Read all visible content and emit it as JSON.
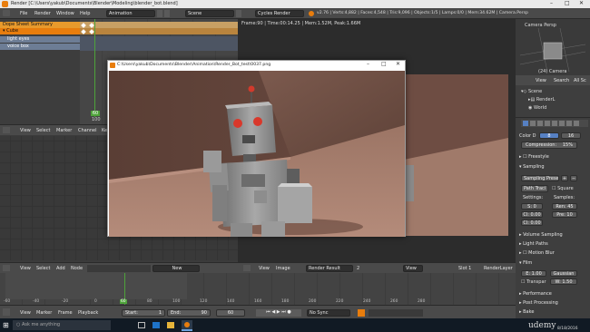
{
  "window": {
    "title": "Render [C:\\Users\\yakub\\Documents\\Blender\\Modeling\\blender_bot.blend]"
  },
  "menu": {
    "items": [
      "File",
      "Render",
      "Window",
      "Help"
    ],
    "layout": "Animation",
    "scene": "Scene",
    "engine": "Cycles Render",
    "stats": "v2.76 | Verts:4,882 | Faces:4,548 | Tris:9,096 | Objects:1/5 | Lamps:0/0 | Mem:34.62M | Camera.Persp"
  },
  "dopesheet": {
    "channels": [
      "Dope Sheet Summary",
      "Cube",
      "light eyes",
      "voice box"
    ],
    "frame_marker": "60",
    "ruler": [
      "60",
      "100"
    ],
    "header_items": [
      "View",
      "Select",
      "Marker",
      "Channel",
      "Key"
    ]
  },
  "image_editor": {
    "info": "Frame:90 | Time:00:14.25 | Mem:1.52M, Peak:1.66M",
    "header_items": [
      "View",
      "Image"
    ],
    "render_result": "Render Result",
    "slot_num": "2",
    "view_label": "View",
    "slot": "Slot 1",
    "layer": "RenderLayer"
  },
  "popup": {
    "title": "C:\\Users\\yakub\\Documents\\Blender\\Animation\\Render_Bot_test\\0037.png"
  },
  "outliner": {
    "view_label": "Camera Persp",
    "camera_label": "(24) Camera",
    "header_items": [
      "View",
      "Search",
      "All Sc"
    ],
    "tree": [
      "Scene",
      "RenderL",
      "World"
    ]
  },
  "properties": {
    "color_d_label": "Color D",
    "color_d_value": "8",
    "color_d_value2": "16",
    "compression_label": "Compression:",
    "compression_value": "15%",
    "freestyle": "Freestyle",
    "sampling": "Sampling",
    "sampling_presets": "Sampling Presets",
    "path_tracing": "Path Traci",
    "square": "Square",
    "settings": "Settings:",
    "samples": "Samples:",
    "seed_label": "S",
    "seed_value": "0",
    "clamp1_label": "Cl",
    "clamp1_value": "0.00",
    "clamp2_label": "Cl",
    "clamp2_value": "0.00",
    "render_samples_label": "Ren",
    "render_samples_value": "45",
    "preview_samples_label": "Pre",
    "preview_samples_value": "10",
    "volume_sampling": "Volume Sampling",
    "light_paths": "Light Paths",
    "motion_blur": "Motion Blur",
    "film": "Film",
    "film_exposure_label": "E",
    "film_exposure_value": "1.00",
    "film_filter": "Gaussian",
    "transparent": "Transpar",
    "filter_width_label": "W",
    "filter_width_value": "1.50",
    "performance": "Performance",
    "post_processing": "Post Processing",
    "bake": "Bake"
  },
  "action_editor": {
    "header_items": [
      "View",
      "Select",
      "Add",
      "Node"
    ],
    "action": "New"
  },
  "timeline": {
    "ticks": [
      "-60",
      "-40",
      "-20",
      "0",
      "20",
      "40",
      "60",
      "80",
      "100",
      "120",
      "140",
      "160",
      "180",
      "200",
      "220",
      "240",
      "260",
      "280"
    ],
    "current_frame": "60",
    "header_items": [
      "View",
      "Marker",
      "Frame",
      "Playback"
    ],
    "start_label": "Start:",
    "start_value": "1",
    "end_label": "End:",
    "end_value": "90",
    "frame_value": "60",
    "sync": "No Sync"
  },
  "taskbar": {
    "search_placeholder": "Ask me anything",
    "time": "8/18/2016",
    "watermark": "udemy"
  },
  "colors": {
    "accent_orange": "#e87d0d",
    "selection_blue": "#5680c2",
    "frame_green": "#4ea33a"
  }
}
